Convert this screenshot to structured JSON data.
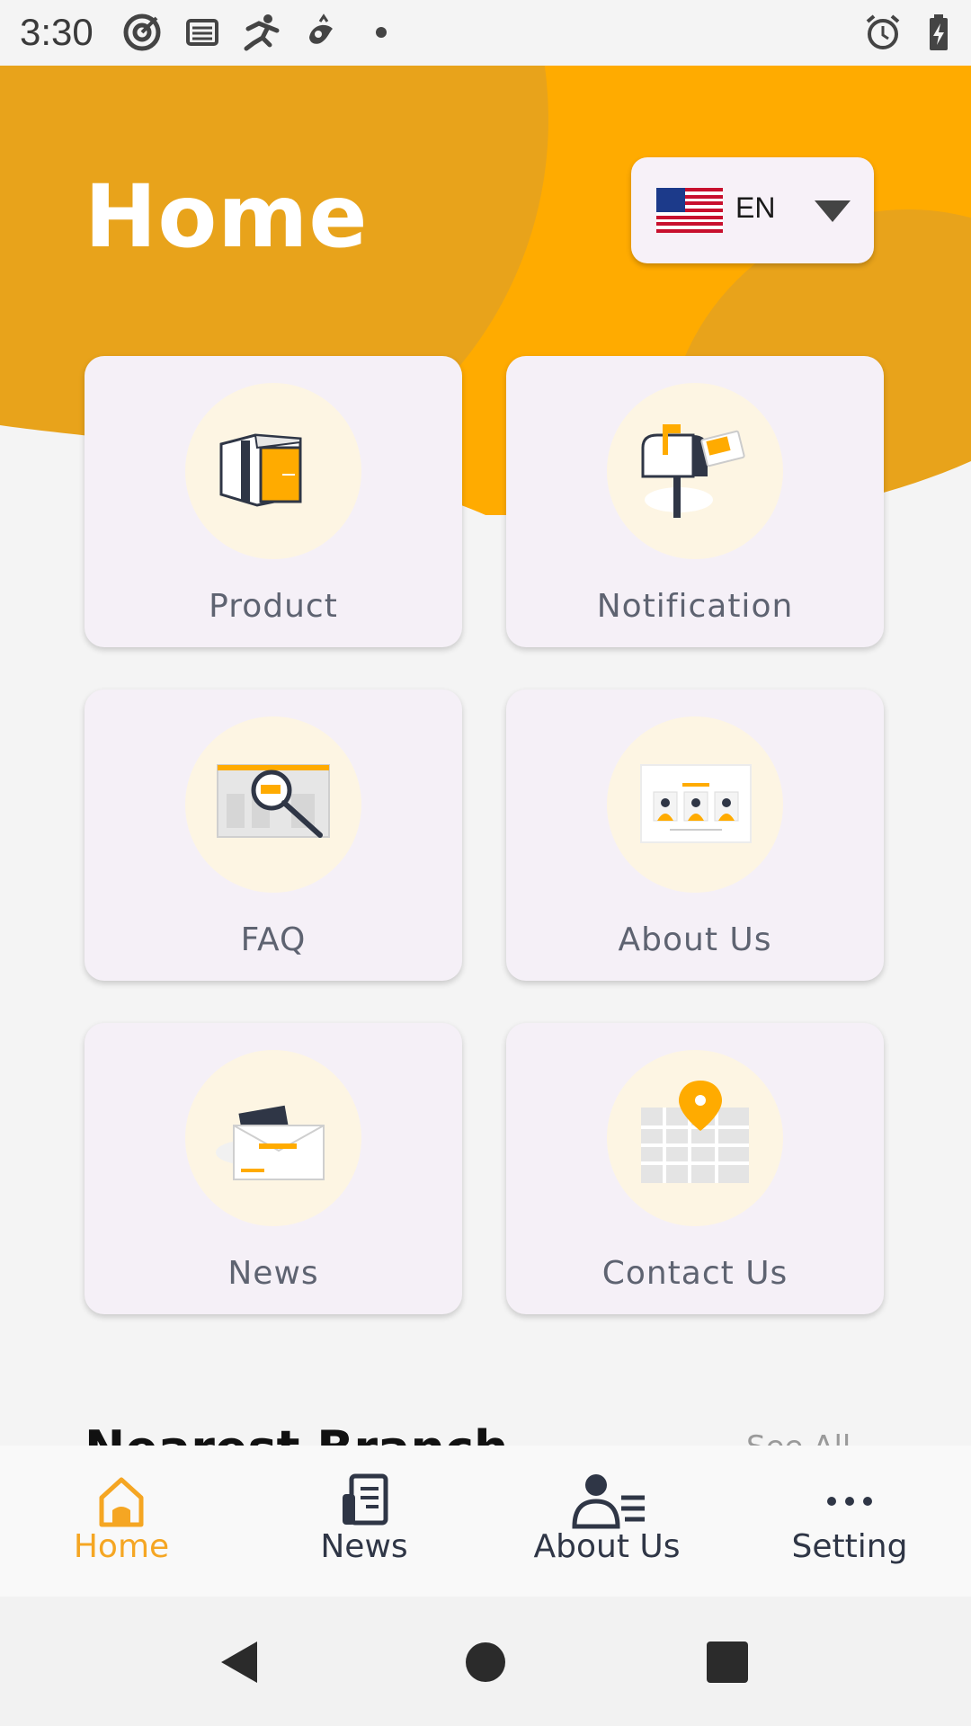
{
  "status_bar": {
    "time": "3:30",
    "icons": [
      "target-icon",
      "list-icon",
      "runner-icon",
      "bird-icon",
      "dot-icon",
      "alarm-icon",
      "battery-charging-icon"
    ]
  },
  "header": {
    "title": "Home",
    "language": {
      "code": "EN",
      "flag": "us-flag-icon"
    }
  },
  "grid": [
    {
      "label": "Product",
      "icon": "box-icon"
    },
    {
      "label": "Notification",
      "icon": "mailbox-icon"
    },
    {
      "label": "FAQ",
      "icon": "magnifier-icon"
    },
    {
      "label": "About Us",
      "icon": "team-board-icon"
    },
    {
      "label": "News",
      "icon": "envelope-icon"
    },
    {
      "label": "Contact Us",
      "icon": "map-pin-icon"
    }
  ],
  "section": {
    "title": "Nearest Branch",
    "see_all": "See All"
  },
  "bottom_nav": {
    "items": [
      {
        "label": "Home",
        "icon": "home-icon",
        "active": true
      },
      {
        "label": "News",
        "icon": "news-icon",
        "active": false
      },
      {
        "label": "About Us",
        "icon": "about-us-icon",
        "active": false
      },
      {
        "label": "Setting",
        "icon": "more-icon",
        "active": false
      }
    ]
  },
  "colors": {
    "accent": "#f5a623",
    "header_orange": "#ffab00",
    "header_dark_orange": "#e8a31b",
    "card_bg": "#f5f0f7",
    "icon_circle": "#fdf5e3",
    "label_gray": "#5e6371",
    "nav_dark": "#2f3646"
  }
}
